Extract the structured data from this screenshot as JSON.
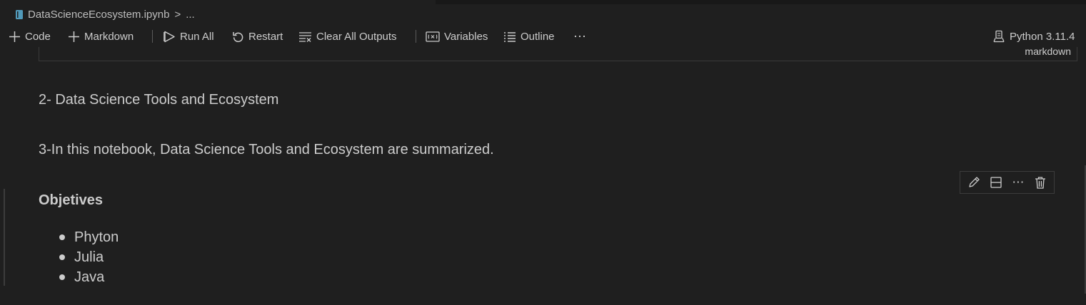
{
  "breadcrumb": {
    "file": "DataScienceEcosystem.ipynb",
    "sep": ">",
    "more": "..."
  },
  "toolbar": {
    "code": "Code",
    "markdown": "Markdown",
    "run_all": "Run All",
    "restart": "Restart",
    "clear_outputs": "Clear All Outputs",
    "variables": "Variables",
    "outline": "Outline",
    "more": "⋯",
    "kernel": "Python 3.11.4"
  },
  "top_cell": {
    "language": "markdown"
  },
  "cells": {
    "line1": "2- Data Science Tools and Ecosystem",
    "line2": "3-In this notebook, Data Science Tools and Ecosystem are summarized.",
    "heading": "Objetives",
    "items": [
      "Phyton",
      "Julia",
      "Java"
    ]
  },
  "cell_toolbar": {
    "more": "⋯"
  },
  "colors": {
    "background": "#1f1f1f",
    "text": "#cccccc",
    "border": "#3c3c3c"
  }
}
